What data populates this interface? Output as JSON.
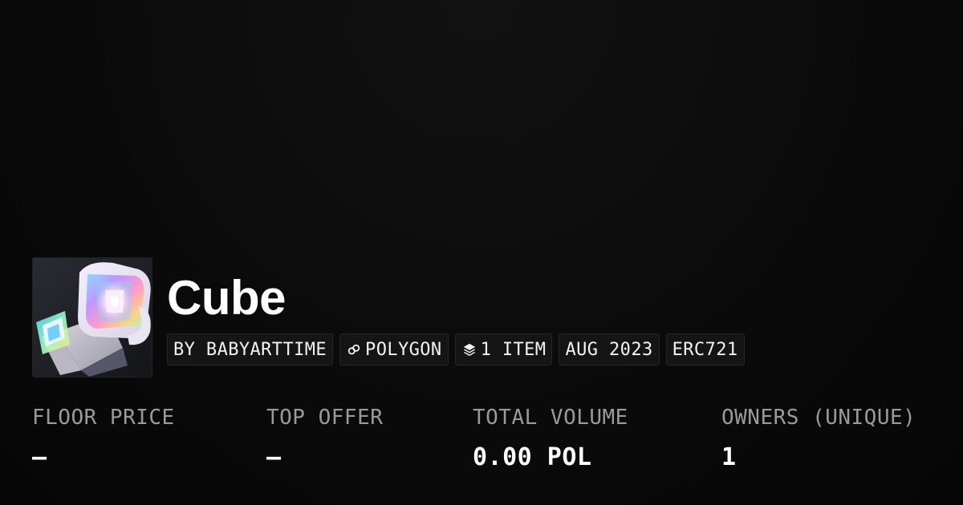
{
  "collection": {
    "title": "Cube",
    "avatar_icon": "cube-artwork",
    "chips": {
      "creator": "BY BABYARTTIME",
      "chain": "POLYGON",
      "chain_icon": "polygon-icon",
      "items": "1 ITEM",
      "items_icon": "layers-icon",
      "date": "AUG 2023",
      "standard": "ERC721"
    }
  },
  "stats": {
    "floor_price": {
      "label": "FLOOR PRICE",
      "value": "–"
    },
    "top_offer": {
      "label": "TOP OFFER",
      "value": "–"
    },
    "total_volume": {
      "label": "TOTAL VOLUME",
      "value": "0.00 POL"
    },
    "owners": {
      "label": "OWNERS (UNIQUE)",
      "value": "1"
    }
  },
  "colors": {
    "background": "#0a0a0a",
    "chip_bg": "#151515",
    "label": "#9a9a9a",
    "text": "#ffffff"
  }
}
